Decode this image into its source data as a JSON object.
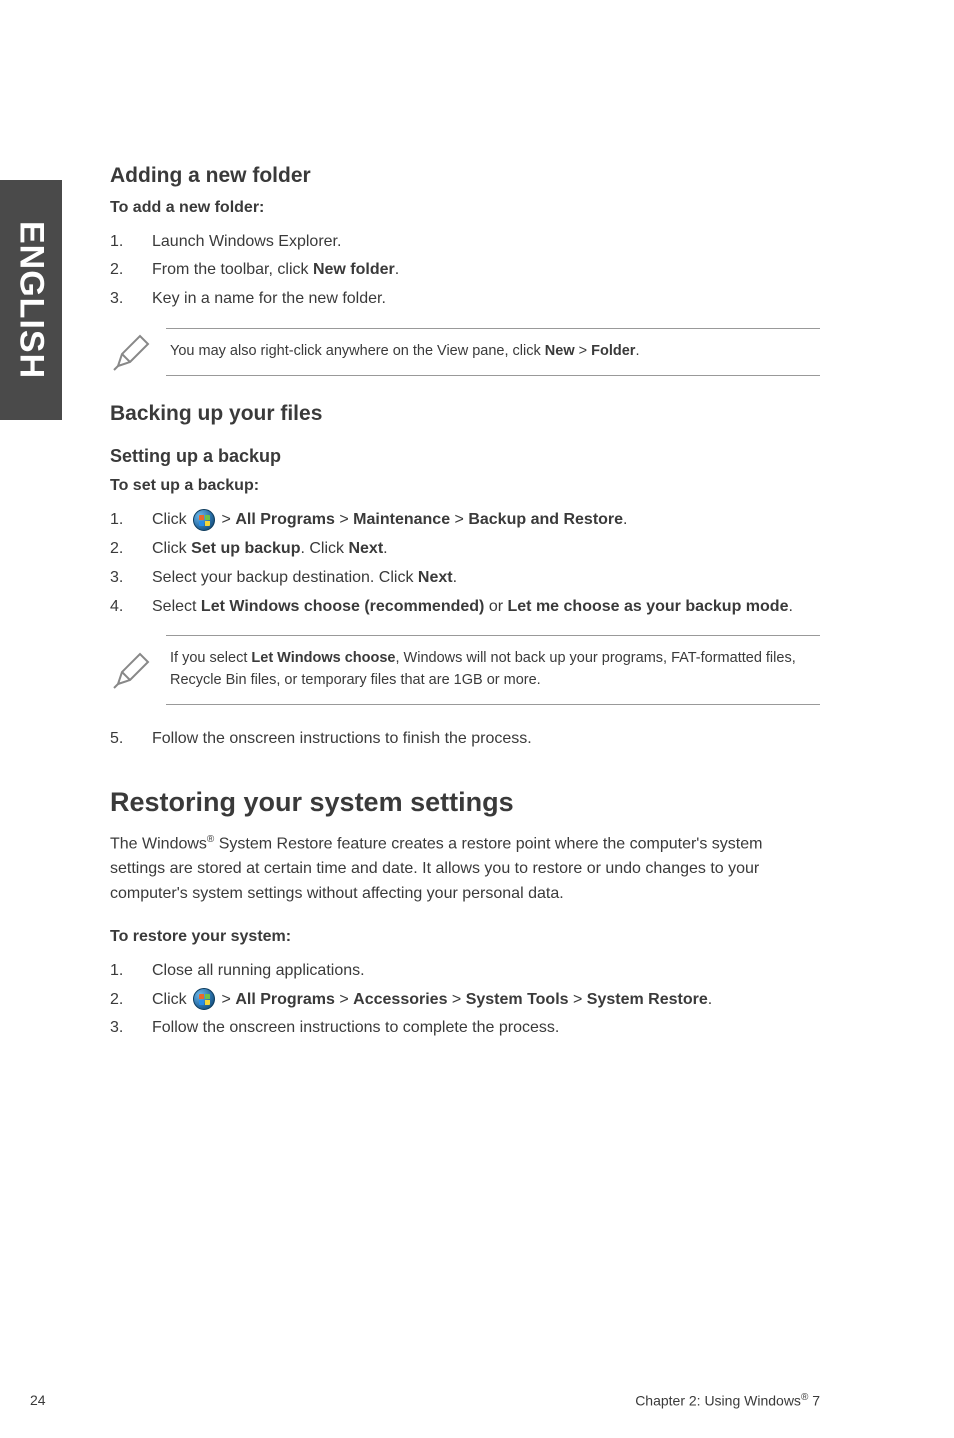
{
  "side_tab": {
    "label": "ENGLISH"
  },
  "adding_folder": {
    "title": "Adding a new folder",
    "subtitle": "To add a new folder:",
    "steps": [
      {
        "n": "1.",
        "text": "Launch Windows Explorer."
      },
      {
        "n": "2.",
        "prefix": "From the toolbar, click ",
        "bold1": "New folder",
        "suffix": "."
      },
      {
        "n": "3.",
        "text": "Key in a name for the new folder."
      }
    ],
    "note_prefix": "You may also right-click anywhere on the View pane, click ",
    "note_b1": "New",
    "note_mid": " > ",
    "note_b2": "Folder",
    "note_suffix": "."
  },
  "backup": {
    "title": "Backing up your files",
    "sub1": "Setting up a backup",
    "sub2": "To set up a backup:",
    "steps": [
      {
        "n": "1.",
        "pre": "Click ",
        "path1": "All Programs",
        "path2": "Maintenance",
        "path3": "Backup and Restore"
      },
      {
        "n": "2.",
        "pre": "Click ",
        "b1": "Set up backup",
        "mid": ". Click ",
        "b2": "Next",
        "suf": "."
      },
      {
        "n": "3.",
        "pre": "Select your backup destination. Click ",
        "b1": "Next",
        "suf": "."
      },
      {
        "n": "4.",
        "pre": "Select ",
        "b1": "Let Windows choose (recommended)",
        "mid": " or ",
        "b2": "Let me choose as your backup mode",
        "suf": "."
      }
    ],
    "note_pre": "If you select ",
    "note_b": "Let Windows choose",
    "note_post": ", Windows will not back up your programs, FAT-formatted files, Recycle Bin files, or temporary files that are 1GB or more.",
    "step5": {
      "n": "5.",
      "text": "Follow the onscreen instructions to finish the process."
    }
  },
  "restore": {
    "title": "Restoring your system settings",
    "para_pre": "The Windows",
    "para_sup": "®",
    "para_post": " System Restore feature creates a restore point where the computer's system settings are stored at certain time and date. It allows you to restore or undo changes to your computer's system settings without affecting your personal data.",
    "subtitle": "To restore your system:",
    "steps": [
      {
        "n": "1.",
        "text": "Close all running applications."
      },
      {
        "n": "2.",
        "pre": "Click ",
        "p1": "All Programs",
        "p2": "Accessories",
        "p3": "System Tools",
        "p4": "System Restore"
      },
      {
        "n": "3.",
        "text": "Follow the onscreen instructions to complete the process."
      }
    ]
  },
  "footer": {
    "page": "24",
    "chapter_pre": "Chapter 2: Using Windows",
    "chapter_sup": "®",
    "chapter_post": " 7"
  }
}
